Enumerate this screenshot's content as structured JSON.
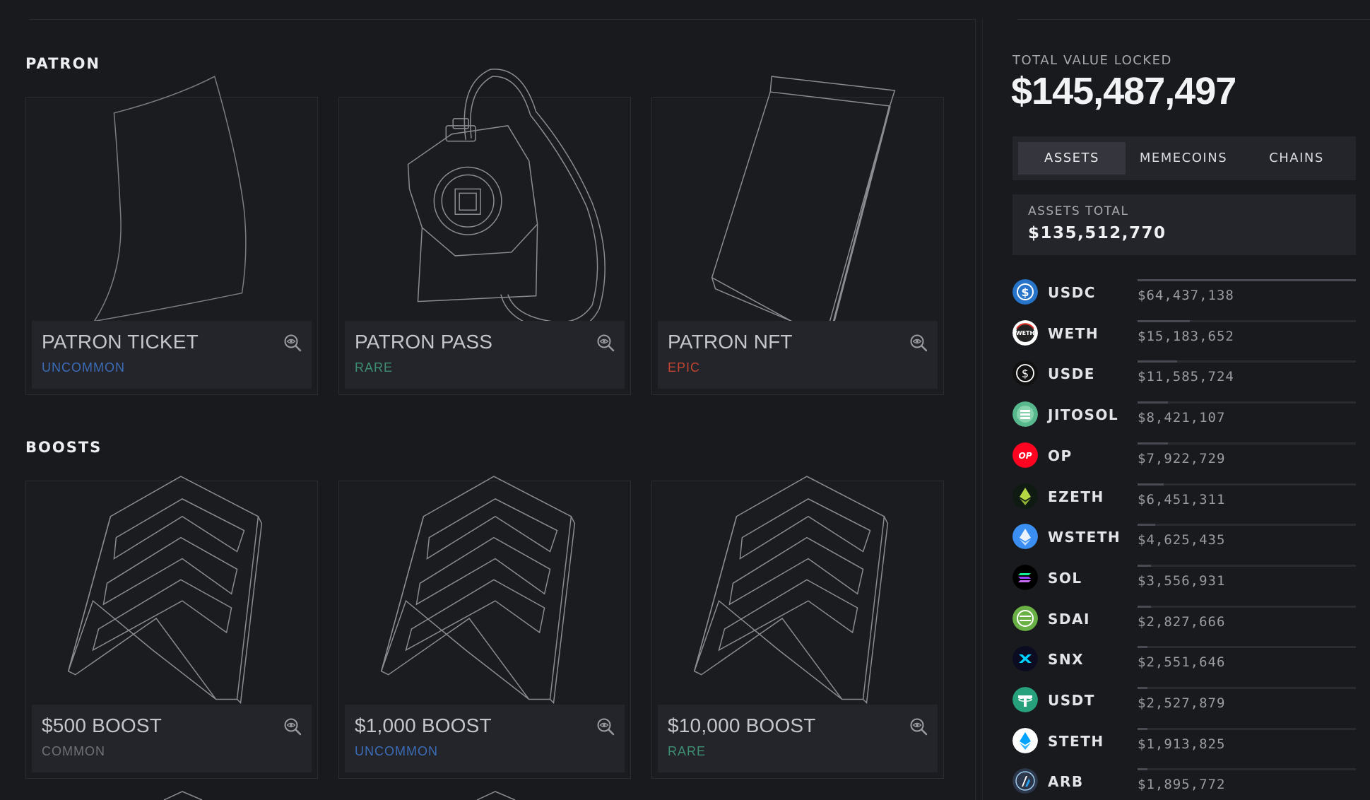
{
  "sections": {
    "patron_title": "PATRON",
    "boosts_title": "BOOSTS"
  },
  "patron_cards": [
    {
      "name": "PATRON TICKET",
      "rarity": "UNCOMMON",
      "rarity_color": "#3b6cb7",
      "art": "ticket"
    },
    {
      "name": "PATRON PASS",
      "rarity": "RARE",
      "rarity_color": "#3e8f72",
      "art": "pass"
    },
    {
      "name": "PATRON NFT",
      "rarity": "EPIC",
      "rarity_color": "#c0442f",
      "art": "nft"
    }
  ],
  "boost_cards": [
    {
      "name": "$500 BOOST",
      "rarity": "COMMON",
      "rarity_color": "#6f7177",
      "art": "chevrons"
    },
    {
      "name": "$1,000 BOOST",
      "rarity": "UNCOMMON",
      "rarity_color": "#3b6cb7",
      "art": "chevrons"
    },
    {
      "name": "$10,000 BOOST",
      "rarity": "RARE",
      "rarity_color": "#3e8f72",
      "art": "chevrons"
    }
  ],
  "card_icon": "zoom-eye-icon",
  "tvl": {
    "label": "TOTAL VALUE LOCKED",
    "value": "$145,487,497"
  },
  "tabs": [
    {
      "label": "ASSETS",
      "active": true
    },
    {
      "label": "MEMECOINS",
      "active": false
    },
    {
      "label": "CHAINS",
      "active": false
    }
  ],
  "assets_total": {
    "label": "ASSETS TOTAL",
    "value": "$135,512,770"
  },
  "assets": [
    {
      "symbol": "USDC",
      "amount": "$64,437,138",
      "share": 1.0,
      "color": "#2775ca",
      "icon": "usdc-icon"
    },
    {
      "symbol": "WETH",
      "amount": "$15,183,652",
      "share": 0.24,
      "color": "#ffffff",
      "icon": "weth-icon"
    },
    {
      "symbol": "USDE",
      "amount": "$11,585,724",
      "share": 0.18,
      "color": "#111111",
      "icon": "usde-icon"
    },
    {
      "symbol": "JITOSOL",
      "amount": "$8,421,107",
      "share": 0.14,
      "color": "#57b88e",
      "icon": "jitosol-icon"
    },
    {
      "symbol": "OP",
      "amount": "$7,922,729",
      "share": 0.14,
      "color": "#ff0420",
      "icon": "op-icon"
    },
    {
      "symbol": "EZETH",
      "amount": "$6,451,311",
      "share": 0.12,
      "color": "#0e1a12",
      "icon": "ezeth-icon"
    },
    {
      "symbol": "WSTETH",
      "amount": "$4,625,435",
      "share": 0.08,
      "color": "#3b8ff3",
      "icon": "wsteth-icon"
    },
    {
      "symbol": "SOL",
      "amount": "$3,556,931",
      "share": 0.06,
      "color": "#000000",
      "icon": "sol-icon"
    },
    {
      "symbol": "SDAI",
      "amount": "$2,827,666",
      "share": 0.06,
      "color": "#6ab045",
      "icon": "sdai-icon"
    },
    {
      "symbol": "SNX",
      "amount": "$2,551,646",
      "share": 0.04,
      "color": "#0b0b22",
      "icon": "snx-icon"
    },
    {
      "symbol": "USDT",
      "amount": "$2,527,879",
      "share": 0.04,
      "color": "#26a17b",
      "icon": "usdt-icon"
    },
    {
      "symbol": "STETH",
      "amount": "$1,913,825",
      "share": 0.04,
      "color": "#ffffff",
      "icon": "steth-icon"
    },
    {
      "symbol": "ARB",
      "amount": "$1,895,772",
      "share": 0.04,
      "color": "#2d374b",
      "icon": "arb-icon"
    }
  ]
}
